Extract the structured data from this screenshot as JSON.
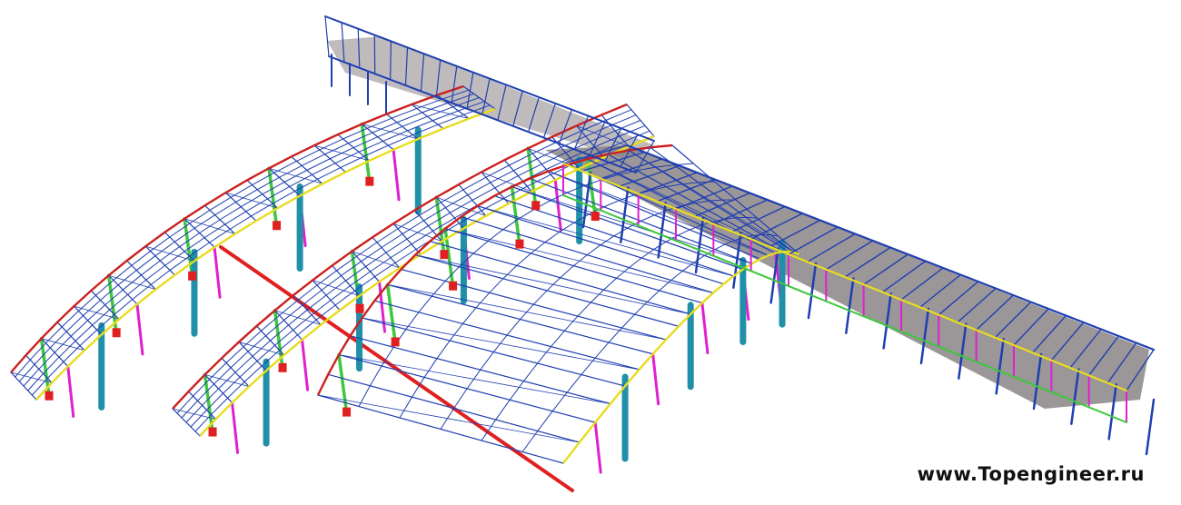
{
  "watermark": {
    "text": "www.Topengineer.ru"
  },
  "colors": {
    "background": "#ffffff",
    "purlin_blue": "#1f3fb0",
    "chord_red": "#cc2020",
    "column_green": "#3cc83c",
    "brace_magenta": "#e020d0",
    "column_teal": "#1f90a8",
    "chord_yellow": "#e8dc20",
    "roof_slab_gray": "#8a8486",
    "base_red": "#e02020"
  },
  "legend": []
}
